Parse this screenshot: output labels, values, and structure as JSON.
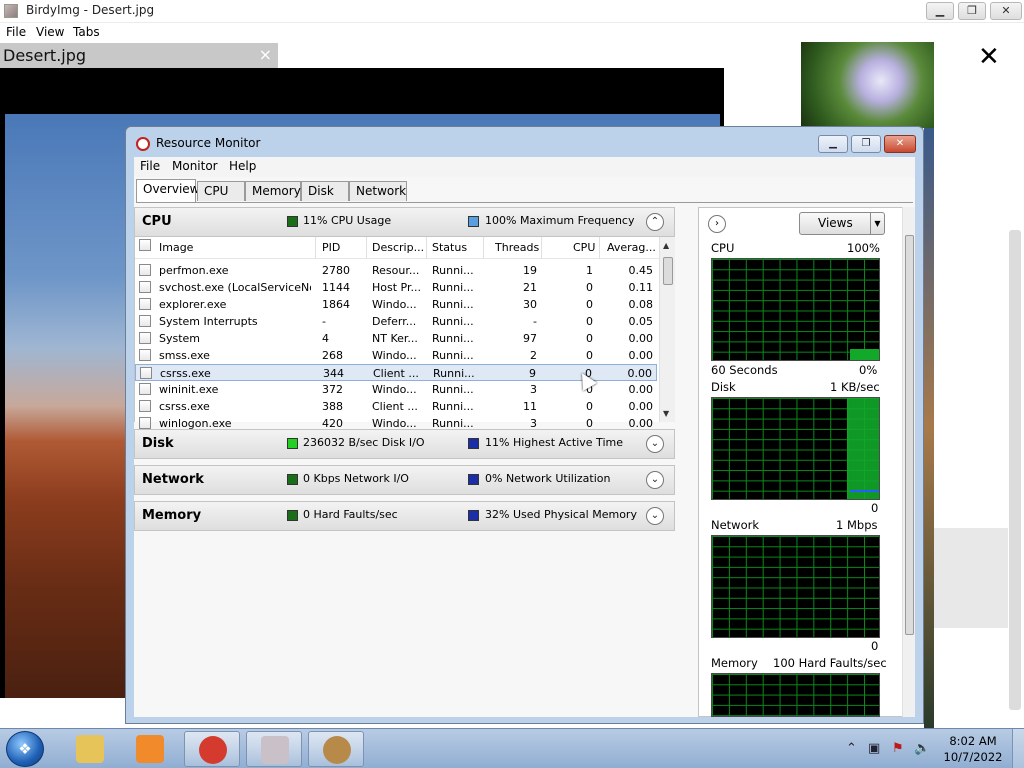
{
  "viewer": {
    "title": "BirdyImg - Desert.jpg",
    "menu": [
      "File",
      "View",
      "Tabs"
    ],
    "tab_label": "Desert.jpg",
    "tab_close": "×",
    "close_glyph": "✕"
  },
  "window_buttons": {
    "minimize": "▁",
    "maximize": "❐",
    "close": "✕"
  },
  "resmon": {
    "title": "Resource Monitor",
    "menu": [
      "File",
      "Monitor",
      "Help"
    ],
    "tabs": [
      "Overview",
      "CPU",
      "Memory",
      "Disk",
      "Network"
    ],
    "active_tab": "Overview",
    "sections": {
      "cpu": {
        "title": "CPU",
        "stat1": "11% CPU Usage",
        "stat1_color": "#1a6e1a",
        "stat2": "100% Maximum Frequency",
        "stat2_color": "#5aa0e0",
        "toggle": "⌃"
      },
      "disk": {
        "title": "Disk",
        "stat1": "236032 B/sec Disk I/O",
        "stat1_color": "#22d022",
        "stat2": "11% Highest Active Time",
        "stat2_color": "#1a2ea8",
        "toggle": "⌄"
      },
      "network": {
        "title": "Network",
        "stat1": "0 Kbps Network I/O",
        "stat1_color": "#1a6e1a",
        "stat2": "0% Network Utilization",
        "stat2_color": "#1a2ea8",
        "toggle": "⌄"
      },
      "memory": {
        "title": "Memory",
        "stat1": "0 Hard Faults/sec",
        "stat1_color": "#1a6e1a",
        "stat2": "32% Used Physical Memory",
        "stat2_color": "#1a2ea8",
        "toggle": "⌄"
      }
    },
    "cpu_table": {
      "columns": [
        "Image",
        "PID",
        "Descrip...",
        "Status",
        "Threads",
        "CPU",
        "Averag..."
      ],
      "rows": [
        [
          "perfmon.exe",
          "2780",
          "Resour...",
          "Runni...",
          "19",
          "1",
          "0.45"
        ],
        [
          "svchost.exe (LocalServiceNo...",
          "1144",
          "Host Pr...",
          "Runni...",
          "21",
          "0",
          "0.11"
        ],
        [
          "explorer.exe",
          "1864",
          "Windo...",
          "Runni...",
          "30",
          "0",
          "0.08"
        ],
        [
          "System Interrupts",
          "-",
          "Deferr...",
          "Runni...",
          "-",
          "0",
          "0.05"
        ],
        [
          "System",
          "4",
          "NT Ker...",
          "Runni...",
          "97",
          "0",
          "0.00"
        ],
        [
          "smss.exe",
          "268",
          "Windo...",
          "Runni...",
          "2",
          "0",
          "0.00"
        ],
        [
          "csrss.exe",
          "344",
          "Client ...",
          "Runni...",
          "9",
          "0",
          "0.00"
        ],
        [
          "wininit.exe",
          "372",
          "Windo...",
          "Runni...",
          "3",
          "0",
          "0.00"
        ],
        [
          "csrss.exe",
          "388",
          "Client ...",
          "Runni...",
          "11",
          "0",
          "0.00"
        ],
        [
          "winlogon.exe",
          "420",
          "Windo...",
          "Runni...",
          "3",
          "0",
          "0.00"
        ]
      ],
      "selected_row": 6
    },
    "graphs": {
      "nav_glyph": "›",
      "views_label": "Views",
      "cpu": {
        "label": "CPU",
        "max": "100%",
        "footer_left": "60 Seconds",
        "footer_right": "0%"
      },
      "disk": {
        "label": "Disk",
        "max": "1 KB/sec",
        "footer_right": "0"
      },
      "network": {
        "label": "Network",
        "max": "1 Mbps",
        "footer_right": "0"
      },
      "memory": {
        "label": "Memory",
        "max": "100 Hard Faults/sec"
      }
    }
  },
  "taskbar": {
    "start_glyph": "❖",
    "clock_time": "8:02 AM",
    "clock_date": "10/7/2022",
    "apps": [
      {
        "name": "explorer",
        "color": "#e6c45a"
      },
      {
        "name": "media-player",
        "color": "#f08a2a"
      },
      {
        "name": "chrome",
        "color": "#d43b2e"
      },
      {
        "name": "birdyimg",
        "color": "#c9c0c8"
      },
      {
        "name": "resource-monitor",
        "color": "#b88a4a"
      }
    ],
    "tray": [
      "⌃",
      "▣",
      "⚑",
      "🔈"
    ]
  }
}
